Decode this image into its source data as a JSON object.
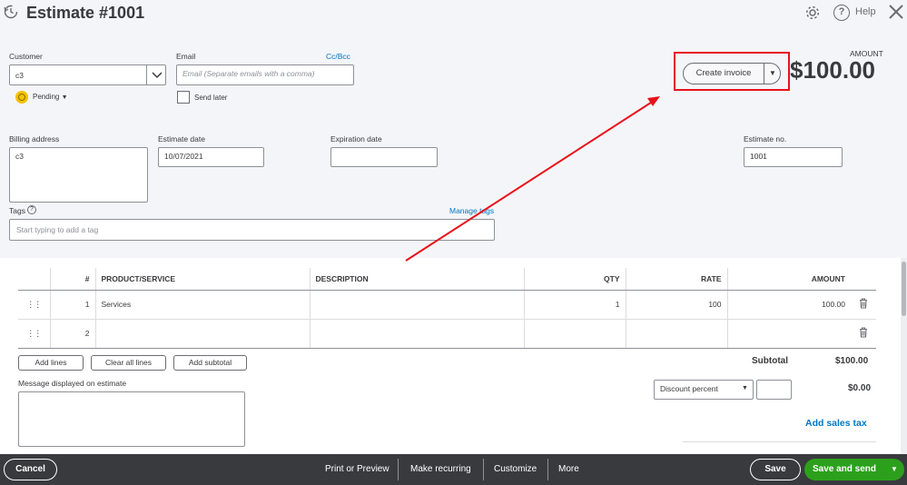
{
  "header": {
    "title": "Estimate #1001",
    "help_label": "Help"
  },
  "customer": {
    "label": "Customer",
    "value": "c3",
    "status": "Pending"
  },
  "email": {
    "label": "Email",
    "cc_bcc": "Cc/Bcc",
    "placeholder": "Email (Separate emails with a comma)",
    "send_later": "Send later"
  },
  "amount": {
    "label": "AMOUNT",
    "value": "$100.00"
  },
  "create_invoice": {
    "label": "Create invoice"
  },
  "billing": {
    "label": "Billing address",
    "value": "c3"
  },
  "estimate_date": {
    "label": "Estimate date",
    "value": "10/07/2021"
  },
  "expiration_date": {
    "label": "Expiration date",
    "value": ""
  },
  "estimate_no": {
    "label": "Estimate no.",
    "value": "1001"
  },
  "tags": {
    "label": "Tags",
    "manage": "Manage tags",
    "placeholder": "Start typing to add a tag"
  },
  "table": {
    "headers": {
      "num": "#",
      "product": "PRODUCT/SERVICE",
      "description": "DESCRIPTION",
      "qty": "QTY",
      "rate": "RATE",
      "amount": "AMOUNT"
    },
    "rows": [
      {
        "num": "1",
        "product": "Services",
        "description": "",
        "qty": "1",
        "rate": "100",
        "amount": "100.00"
      },
      {
        "num": "2",
        "product": "",
        "description": "",
        "qty": "",
        "rate": "",
        "amount": ""
      }
    ]
  },
  "line_buttons": {
    "add_lines": "Add lines",
    "clear_all": "Clear all lines",
    "add_subtotal": "Add subtotal"
  },
  "message": {
    "label": "Message displayed on estimate",
    "value": ""
  },
  "totals": {
    "subtotal_label": "Subtotal",
    "subtotal_value": "$100.00",
    "discount_select": "Discount percent",
    "discount_input": "",
    "discount_value": "$0.00",
    "add_sales_tax": "Add sales tax"
  },
  "footer": {
    "cancel": "Cancel",
    "print_preview": "Print or Preview",
    "make_recurring": "Make recurring",
    "customize": "Customize",
    "more": "More",
    "save": "Save",
    "save_and_send": "Save and send"
  },
  "colors": {
    "highlight_box": "#e8111b",
    "annotation_arrow": "#e8111b",
    "primary_green": "#2ca01c",
    "footer_bg": "#393a3d",
    "link_blue": "#0077c5"
  }
}
